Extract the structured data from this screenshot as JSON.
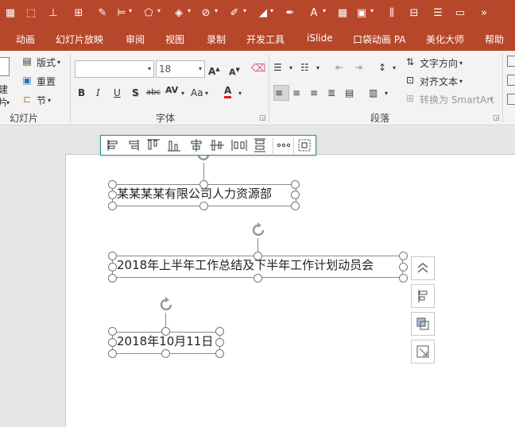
{
  "tabs": [
    "动画",
    "幻灯片放映",
    "审阅",
    "视图",
    "录制",
    "开发工具",
    "iSlide",
    "口袋动画 PA",
    "美化大师",
    "帮助"
  ],
  "ribbon": {
    "slides_group": {
      "new_slide_partial_1": "建",
      "new_slide_partial_2": "片",
      "layout": "版式",
      "reset": "重置",
      "section": "节",
      "label": "幻灯片"
    },
    "font_group": {
      "font_name": "",
      "font_size": "18",
      "label": "字体",
      "bold": "B",
      "italic": "I",
      "underline": "U",
      "shadow": "S",
      "strikethrough": "abc",
      "char_spacing": "AV",
      "change_case": "Aa",
      "font_color": "A"
    },
    "paragraph_group": {
      "text_direction": "文字方向",
      "align_text": "对齐文本",
      "convert_smartart": "转换为 SmartArt",
      "label": "段落"
    }
  },
  "slide": {
    "text1": "某某某某有限公司人力资源部",
    "text2": "2018年上半年工作总结及下半年工作计划动员会",
    "text3": "2018年10月11日"
  },
  "colors": {
    "title_bar": "#b7472a",
    "ribbon_bg": "#f3f3f3",
    "align_bar_border": "#2d8c8c"
  }
}
